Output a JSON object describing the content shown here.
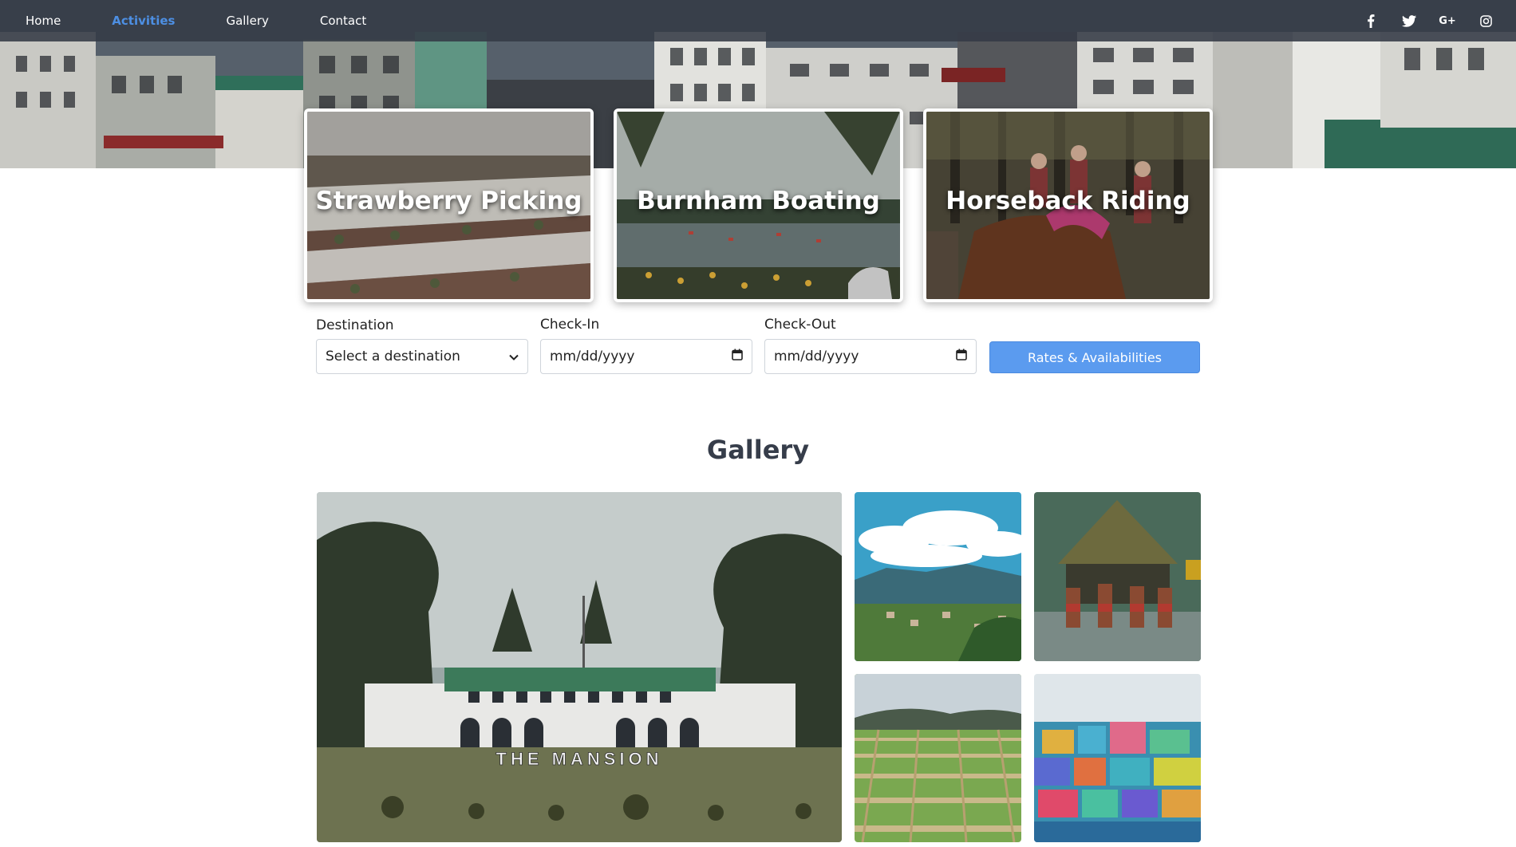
{
  "nav": {
    "links": [
      {
        "label": "Home",
        "active": false
      },
      {
        "label": "Activities",
        "active": true
      },
      {
        "label": "Gallery",
        "active": false
      },
      {
        "label": "Contact",
        "active": false
      }
    ],
    "social_icons": [
      "facebook-icon",
      "twitter-icon",
      "google-plus-icon",
      "instagram-icon"
    ],
    "google_plus_text": "G+"
  },
  "activities": [
    {
      "title": "Strawberry Picking"
    },
    {
      "title": "Burnham Boating"
    },
    {
      "title": "Horseback Riding"
    }
  ],
  "booking": {
    "destination_label": "Destination",
    "destination_value": "Select a destination",
    "checkin_label": "Check-In",
    "checkin_placeholder": "mm/dd/yyyy",
    "checkout_label": "Check-Out",
    "checkout_placeholder": "mm/dd/yyyy",
    "submit_label": "Rates & Availabilities"
  },
  "gallery": {
    "title": "Gallery",
    "featured_sign_text": "THE MANSION"
  },
  "colors": {
    "accent": "#4d8fe3",
    "button": "#5b9bef",
    "navbar": "#343a46",
    "heading": "#363d4a"
  }
}
